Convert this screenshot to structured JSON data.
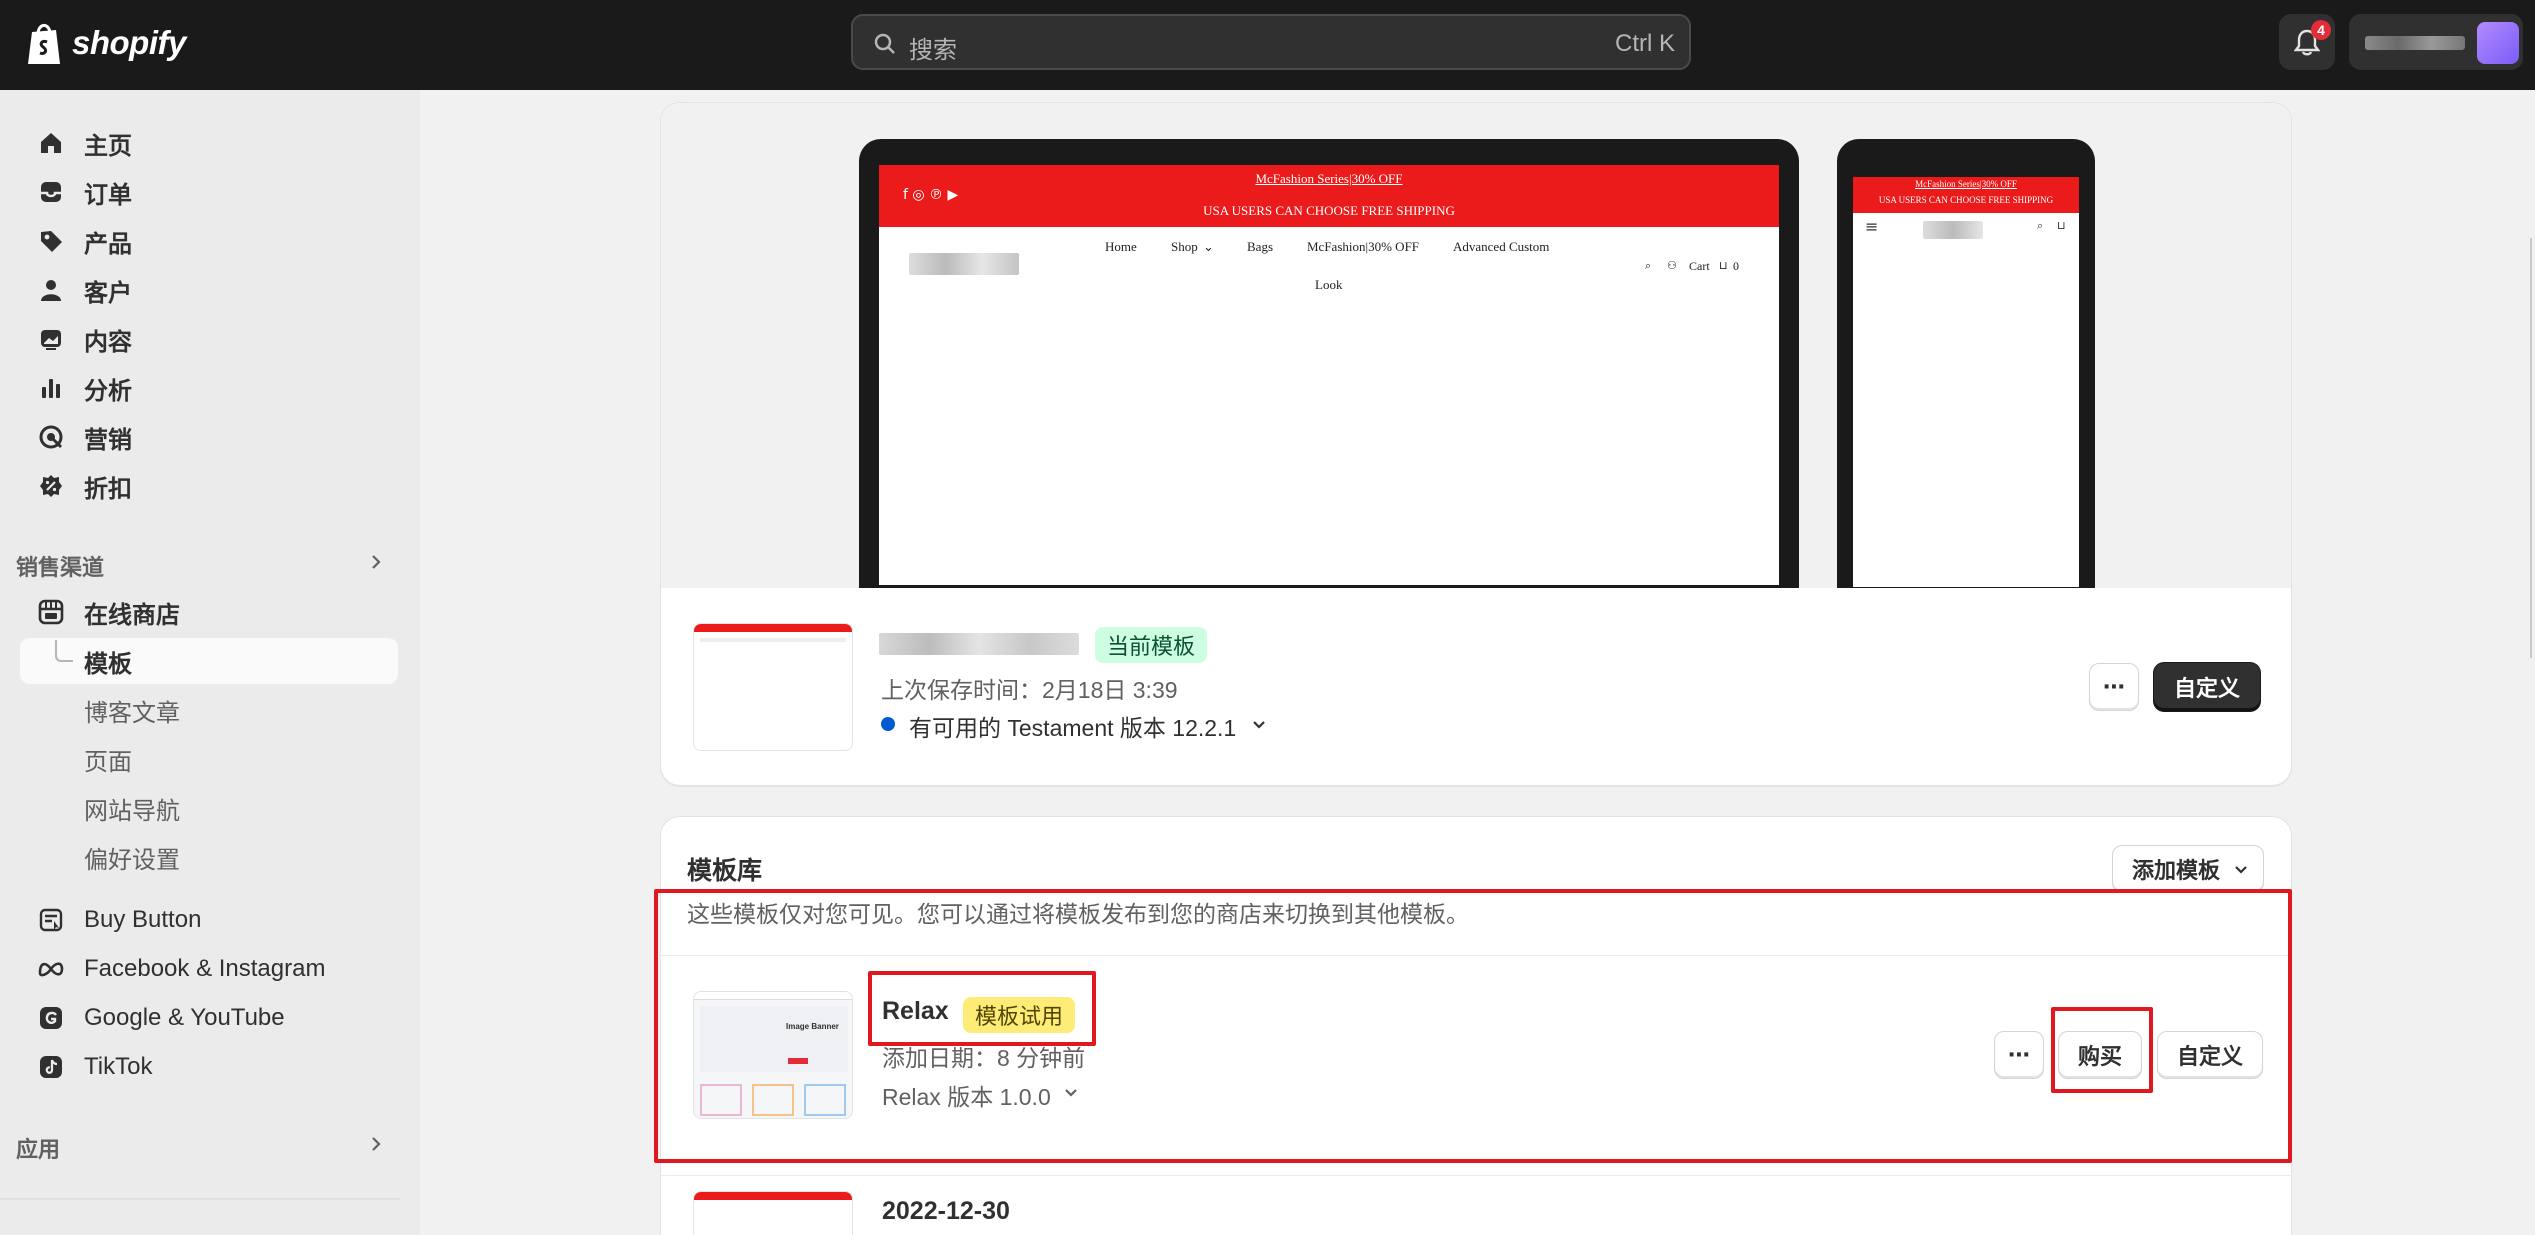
{
  "topbar": {
    "brand": "shopify",
    "search_placeholder": "搜索",
    "search_shortcut": "Ctrl K",
    "notification_count": "4"
  },
  "sidebar": {
    "main_items": [
      {
        "label": "主页",
        "icon": "home-icon"
      },
      {
        "label": "订单",
        "icon": "inbox-icon"
      },
      {
        "label": "产品",
        "icon": "tag-icon"
      },
      {
        "label": "客户",
        "icon": "person-icon"
      },
      {
        "label": "内容",
        "icon": "image-icon"
      },
      {
        "label": "分析",
        "icon": "bar-chart-icon"
      },
      {
        "label": "营销",
        "icon": "target-icon"
      },
      {
        "label": "折扣",
        "icon": "discount-icon"
      }
    ],
    "sales_channels_header": "销售渠道",
    "online_store": "在线商店",
    "online_store_sub": [
      "模板",
      "博客文章",
      "页面",
      "网站导航",
      "偏好设置"
    ],
    "channels": [
      {
        "label": "Buy Button",
        "icon": "buy-button-icon"
      },
      {
        "label": "Facebook & Instagram",
        "icon": "meta-icon"
      },
      {
        "label": "Google & YouTube",
        "icon": "google-icon"
      },
      {
        "label": "TikTok",
        "icon": "tiktok-icon"
      }
    ],
    "apps_header": "应用"
  },
  "preview": {
    "announcement_line1": "McFashion Series|30% OFF",
    "announcement_line2": "USA USERS CAN CHOOSE FREE SHIPPING",
    "nav_links": [
      "Home",
      "Shop",
      "Bags",
      "McFashion|30% OFF",
      "Advanced Custom",
      "Look"
    ],
    "cart_label": "Cart",
    "cart_count": "0"
  },
  "current_theme": {
    "badge": "当前模板",
    "saved": "上次保存时间：2月18日 3:39",
    "update": "有可用的 Testament 版本 12.2.1",
    "customize": "自定义",
    "more": "⋯"
  },
  "library": {
    "title": "模板库",
    "add_button": "添加模板",
    "description": "这些模板仅对您可见。您可以通过将模板发布到您的商店来切换到其他模板。",
    "themes": [
      {
        "name": "Relax",
        "badge": "模板试用",
        "added": "添加日期：8 分钟前",
        "version": "Relax 版本 1.0.0",
        "buy": "购买",
        "customize": "自定义",
        "thumb_heading": "Image Banner"
      },
      {
        "name": "2022-12-30"
      }
    ]
  },
  "colors": {
    "accent_red": "#e0181f",
    "topbar": "#1a1a1a",
    "success_badge": "#cdfee1",
    "warning_badge": "#ffeb78"
  }
}
